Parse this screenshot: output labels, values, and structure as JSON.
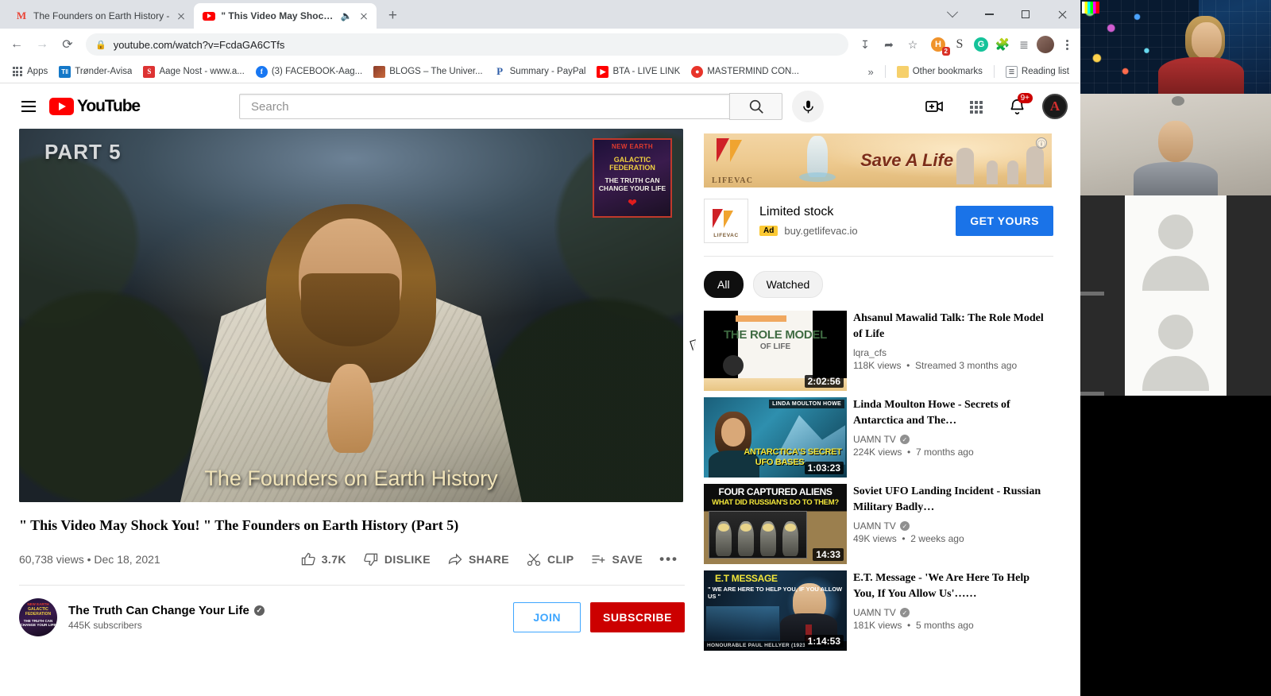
{
  "browser": {
    "tabs": [
      {
        "title": "The Founders on Earth History -",
        "icon": "gmail-icon",
        "active": false
      },
      {
        "title": "\" This Video May Shock Yo",
        "icon": "youtube-icon",
        "active": true,
        "muted_audio": true
      }
    ],
    "new_tab_label": "+",
    "window_controls": {
      "minimize": "—",
      "maximize": "□",
      "close": "✕"
    },
    "nav": {
      "back": "←",
      "forward": "→",
      "reload": "⟳"
    },
    "omnibox": {
      "url": "youtube.com/watch?v=FcdaGA6CTfs",
      "lock": "🔒"
    },
    "omnibox_icons": [
      "install-icon",
      "share-icon",
      "bookmark-star-icon"
    ],
    "extensions": [
      {
        "name": "honey-extension-icon",
        "badge": "2"
      },
      {
        "name": "s-extension-icon",
        "badge": ""
      },
      {
        "name": "grammarly-extension-icon",
        "badge": ""
      },
      {
        "name": "puzzle-extensions-icon",
        "badge": ""
      },
      {
        "name": "playlist-extension-icon",
        "badge": ""
      }
    ],
    "bookmarks": [
      {
        "label": "Apps",
        "icon": "apps-grid-icon"
      },
      {
        "label": "Trønder-Avisa",
        "icon": "ta-icon"
      },
      {
        "label": "Aage Nost - www.a...",
        "icon": "s-icon"
      },
      {
        "label": "(3) FACEBOOK-Aag...",
        "icon": "facebook-icon"
      },
      {
        "label": "BLOGS – The Univer...",
        "icon": "blogs-icon"
      },
      {
        "label": "Summary - PayPal",
        "icon": "paypal-icon"
      },
      {
        "label": "BTA - LIVE LINK",
        "icon": "youtube-icon"
      },
      {
        "label": "MASTERMIND CON...",
        "icon": "mastermind-icon"
      }
    ],
    "bookmarks_overflow": "»",
    "other_bookmarks": "Other bookmarks",
    "reading_list": "Reading list"
  },
  "youtube": {
    "header": {
      "menu": "hamburger-menu",
      "logo_text": "YouTube",
      "search_placeholder": "Search",
      "search_button": "search-icon",
      "mic_button": "microphone-icon",
      "create_button": "create-video-icon",
      "apps_button": "youtube-apps-icon",
      "notifications_badge": "9+",
      "avatar_letter": "A"
    },
    "player": {
      "part_label": "PART 5",
      "subtitle": "The Founders on Earth History",
      "watermark": {
        "line1": "NEW EARTH",
        "line2": "GALACTIC FEDERATION",
        "line3": "THE TRUTH CAN CHANGE YOUR LIFE"
      }
    },
    "video": {
      "title": "\" This Video May Shock You! \" The Founders on Earth History (Part 5)",
      "views": "60,738 views",
      "date": "Dec 18, 2021",
      "separator": "•",
      "actions": [
        {
          "label": "3.7K",
          "icon": "thumbs-up-icon"
        },
        {
          "label": "DISLIKE",
          "icon": "thumbs-down-icon"
        },
        {
          "label": "SHARE",
          "icon": "share-arrow-icon"
        },
        {
          "label": "CLIP",
          "icon": "scissors-icon"
        },
        {
          "label": "SAVE",
          "icon": "save-playlist-icon"
        },
        {
          "label": "•••",
          "icon": "more-actions-icon"
        }
      ]
    },
    "channel": {
      "name": "The Truth Can Change Your Life",
      "verified": true,
      "subscribers": "445K subscribers",
      "join_label": "JOIN",
      "subscribe_label": "SUBSCRIBE",
      "avatar": {
        "l1": "NEW EARTH",
        "l2": "GALACTIC FEDERATION",
        "l3": "THE TRUTH CAN CHANGE YOUR LIFE"
      }
    },
    "ad": {
      "banner_text": "Save A Life",
      "brand": "LIFEVAC",
      "title": "Limited stock",
      "badge": "Ad",
      "url": "buy.getlifevac.io",
      "cta": "GET YOURS",
      "info_icon": "ⓘ"
    },
    "filters": [
      {
        "label": "All",
        "active": true
      },
      {
        "label": "Watched",
        "active": false
      }
    ],
    "recommendations": [
      {
        "title": "Ahsanul Mawalid Talk: The Role Model of Life",
        "channel": "lqra_cfs",
        "verified": false,
        "views": "118K views",
        "age": "Streamed 3 months ago",
        "duration": "2:02:56",
        "thumb": "role-model-of-life",
        "thumb_text": {
          "h1": "THE ROLE MODEL",
          "h2": "OF LIFE"
        }
      },
      {
        "title": "Linda Moulton Howe - Secrets of Antarctica and The…",
        "channel": "UAMN TV",
        "verified": true,
        "views": "224K views",
        "age": "7 months ago",
        "duration": "1:03:23",
        "thumb": "linda-moulton-howe",
        "thumb_text": {
          "label": "LINDA MOULTON HOWE",
          "y1": "ANTARCTICA'S SECRET",
          "y2": "UFO BASES"
        }
      },
      {
        "title": "Soviet UFO Landing Incident - Russian Military Badly…",
        "channel": "UAMN TV",
        "verified": true,
        "views": "49K views",
        "age": "2 weeks ago",
        "duration": "14:33",
        "thumb": "four-captured-aliens",
        "thumb_text": {
          "t1": "FOUR CAPTURED ALIENS",
          "t2": "WHAT DID RUSSIAN'S DO TO THEM?"
        }
      },
      {
        "title": "E.T. Message - 'We Are Here To Help You, If You Allow Us'……",
        "channel": "UAMN TV",
        "verified": true,
        "views": "181K views",
        "age": "5 months ago",
        "duration": "1:14:53",
        "thumb": "et-message",
        "thumb_text": {
          "t1": "E.T MESSAGE",
          "t2": "\" WE ARE HERE TO HELP YOU, IF YOU ALLOW US \"",
          "bar": "HONOURABLE PAUL HELLYER (1923"
        }
      }
    ]
  },
  "conference": {
    "participants": [
      {
        "name": "participant-video-wall",
        "has_video": true
      },
      {
        "name": "participant-second-speaker",
        "has_video": true
      },
      {
        "name": "participant-placeholder-1",
        "has_video": false
      },
      {
        "name": "participant-placeholder-2",
        "has_video": false
      }
    ]
  },
  "colors": {
    "youtube_red": "#FF0000",
    "subscribe_red": "#cc0000",
    "join_blue": "#3ea6ff",
    "ad_cta_blue": "#1a73e8",
    "chip_active": "#0f0f0f",
    "badge_red": "#d93025"
  }
}
